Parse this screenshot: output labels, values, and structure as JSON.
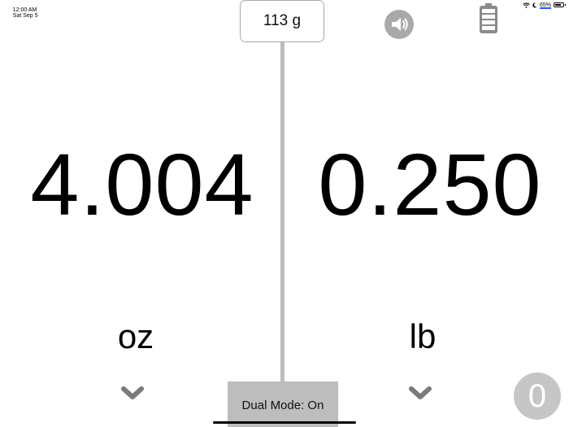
{
  "status_bar": {
    "time": "12:00 AM",
    "date": "Sat Sep 5",
    "battery_percent": "65%",
    "icons": [
      "wifi-icon",
      "moon-icon",
      "battery-icon"
    ]
  },
  "grams_display": {
    "text": "113 g"
  },
  "left": {
    "value": "4.004",
    "unit": "oz"
  },
  "right": {
    "value": "0.250",
    "unit": "lb"
  },
  "dual_mode": {
    "label": "Dual Mode: On"
  },
  "zero_button": {
    "label": "0"
  },
  "colors": {
    "divider": "#bdbdbd",
    "button_gray": "#bdbdbd",
    "icon_gray": "#a9a9a9",
    "zero_gray": "#c6c6c6",
    "chevron_gray": "#7a7a7a"
  },
  "icons": {
    "sound": "speaker-icon",
    "battery": "battery-icon",
    "unit_picker": "chevron-down-icon"
  }
}
